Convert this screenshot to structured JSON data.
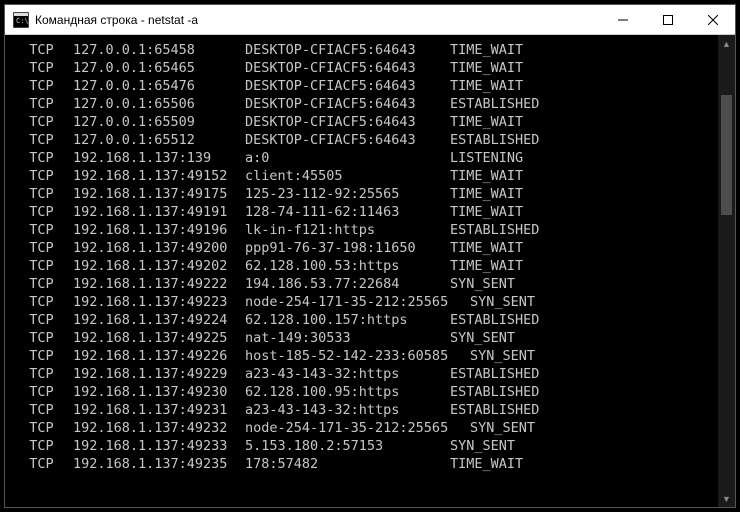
{
  "window": {
    "title": "Командная строка - netstat  -a"
  },
  "rows": [
    {
      "proto": "TCP",
      "local": "127.0.0.1:65458",
      "remote": "DESKTOP-CFIACF5:64643",
      "state": "TIME_WAIT"
    },
    {
      "proto": "TCP",
      "local": "127.0.0.1:65465",
      "remote": "DESKTOP-CFIACF5:64643",
      "state": "TIME_WAIT"
    },
    {
      "proto": "TCP",
      "local": "127.0.0.1:65476",
      "remote": "DESKTOP-CFIACF5:64643",
      "state": "TIME_WAIT"
    },
    {
      "proto": "TCP",
      "local": "127.0.0.1:65506",
      "remote": "DESKTOP-CFIACF5:64643",
      "state": "ESTABLISHED"
    },
    {
      "proto": "TCP",
      "local": "127.0.0.1:65509",
      "remote": "DESKTOP-CFIACF5:64643",
      "state": "TIME_WAIT"
    },
    {
      "proto": "TCP",
      "local": "127.0.0.1:65512",
      "remote": "DESKTOP-CFIACF5:64643",
      "state": "ESTABLISHED"
    },
    {
      "proto": "TCP",
      "local": "192.168.1.137:139",
      "remote": "a:0",
      "state": "LISTENING"
    },
    {
      "proto": "TCP",
      "local": "192.168.1.137:49152",
      "remote": "client:45505",
      "state": "TIME_WAIT"
    },
    {
      "proto": "TCP",
      "local": "192.168.1.137:49175",
      "remote": "125-23-112-92:25565",
      "state": "TIME_WAIT"
    },
    {
      "proto": "TCP",
      "local": "192.168.1.137:49191",
      "remote": "128-74-111-62:11463",
      "state": "TIME_WAIT"
    },
    {
      "proto": "TCP",
      "local": "192.168.1.137:49196",
      "remote": "lk-in-f121:https",
      "state": "ESTABLISHED"
    },
    {
      "proto": "TCP",
      "local": "192.168.1.137:49200",
      "remote": "ppp91-76-37-198:11650",
      "state": "TIME_WAIT"
    },
    {
      "proto": "TCP",
      "local": "192.168.1.137:49202",
      "remote": "62.128.100.53:https",
      "state": "TIME_WAIT"
    },
    {
      "proto": "TCP",
      "local": "192.168.1.137:49222",
      "remote": "194.186.53.77:22684",
      "state": "SYN_SENT"
    },
    {
      "proto": "TCP",
      "local": "192.168.1.137:49223",
      "remote": "node-254-171-35-212:25565",
      "state": "SYN_SENT",
      "wide": true
    },
    {
      "proto": "TCP",
      "local": "192.168.1.137:49224",
      "remote": "62.128.100.157:https",
      "state": "ESTABLISHED"
    },
    {
      "proto": "TCP",
      "local": "192.168.1.137:49225",
      "remote": "nat-149:30533",
      "state": "SYN_SENT"
    },
    {
      "proto": "TCP",
      "local": "192.168.1.137:49226",
      "remote": "host-185-52-142-233:60585",
      "state": "SYN_SENT",
      "wide": true
    },
    {
      "proto": "TCP",
      "local": "192.168.1.137:49229",
      "remote": "a23-43-143-32:https",
      "state": "ESTABLISHED"
    },
    {
      "proto": "TCP",
      "local": "192.168.1.137:49230",
      "remote": "62.128.100.95:https",
      "state": "ESTABLISHED"
    },
    {
      "proto": "TCP",
      "local": "192.168.1.137:49231",
      "remote": "a23-43-143-32:https",
      "state": "ESTABLISHED"
    },
    {
      "proto": "TCP",
      "local": "192.168.1.137:49232",
      "remote": "node-254-171-35-212:25565",
      "state": "SYN_SENT",
      "wide": true
    },
    {
      "proto": "TCP",
      "local": "192.168.1.137:49233",
      "remote": "5.153.180.2:57153",
      "state": "SYN_SENT"
    },
    {
      "proto": "TCP",
      "local": "192.168.1.137:49235",
      "remote": "178:57482",
      "state": "TIME_WAIT"
    }
  ]
}
